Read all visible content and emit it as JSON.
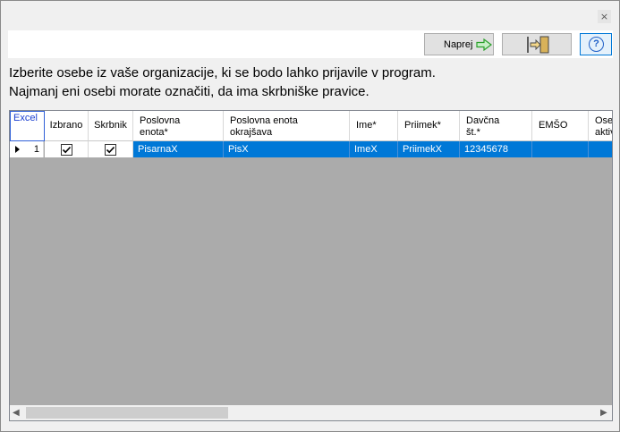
{
  "window": {
    "close_glyph": "×"
  },
  "toolbar": {
    "next_label": "Naprej",
    "next_icon": "arrow-right-icon",
    "exit_icon": "exit-door-icon",
    "help_glyph": "?"
  },
  "instructions": {
    "line1": "Izberite osebe iz vaše organizacije, ki se bodo lahko prijavile v program.",
    "line2": "Najmanj eni osebi morate označiti, da ima skrbniške pravice."
  },
  "grid": {
    "excel_button": "Excel",
    "columns": [
      "Izbrano",
      "Skrbnik",
      "Poslovna\nenota*",
      "Poslovna enota\nokrajšava",
      "Ime*",
      "Priimek*",
      "Davčna\nšt.*",
      "EMŠO",
      "Ose\naktiv"
    ],
    "rows": [
      {
        "num": "1",
        "izbrano": true,
        "skrbnik": true,
        "poslovna_enota": "PisarnaX",
        "okrajsava": "PisX",
        "ime": "ImeX",
        "priimek": "PriimekX",
        "davcna": "12345678",
        "emso": "",
        "aktiv": ""
      }
    ]
  },
  "colors": {
    "selection": "#0078d7",
    "grid_empty": "#ababab"
  }
}
